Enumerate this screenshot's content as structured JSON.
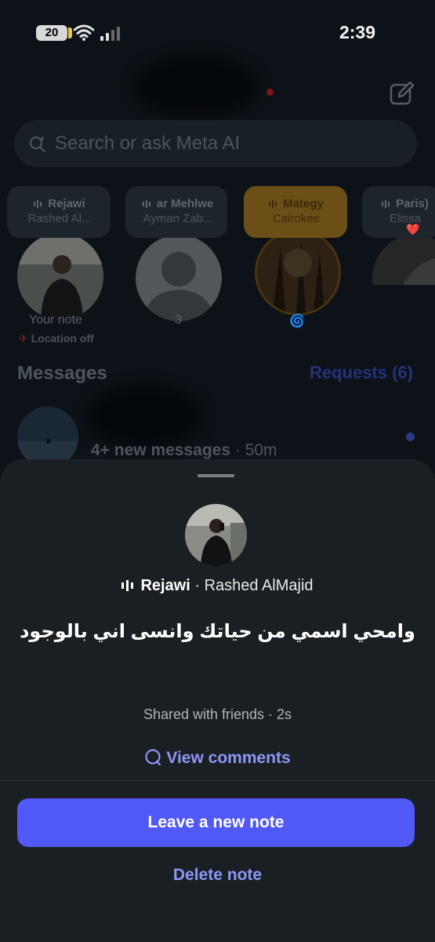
{
  "status_bar": {
    "battery": "20",
    "time": "2:39"
  },
  "search": {
    "placeholder": "Search or ask Meta AI"
  },
  "notes": [
    {
      "title": "Rejawi",
      "artist": "Rashed Al...",
      "label": "Your note",
      "sublabel": "Location off"
    },
    {
      "title": "ar Mehlwe",
      "artist": "Ayman Zab...",
      "label": "3"
    },
    {
      "title": "Mategy",
      "artist": "Cairokee",
      "label": "🌀"
    },
    {
      "title": "Paris)",
      "artist": "Elissa",
      "artist_emoji": "❤️",
      "label": "👷"
    }
  ],
  "messages": {
    "title": "Messages",
    "requests": "Requests (6)",
    "preview": "4+ new messages",
    "time": " · 50m"
  },
  "sheet": {
    "song_title": "Rejawi",
    "separator": " · ",
    "song_artist": "Rashed AlMajid",
    "note_text": "وامحي اسمي من حياتك وانسى اني بالوجود",
    "shared": "Shared with friends · 2s",
    "view_comments": "View comments",
    "leave_button": "Leave a new note",
    "delete_button": "Delete note"
  },
  "colors": {
    "accent": "#5058f6",
    "link": "#8d97f6",
    "sheet_bg": "#1a1f24"
  }
}
